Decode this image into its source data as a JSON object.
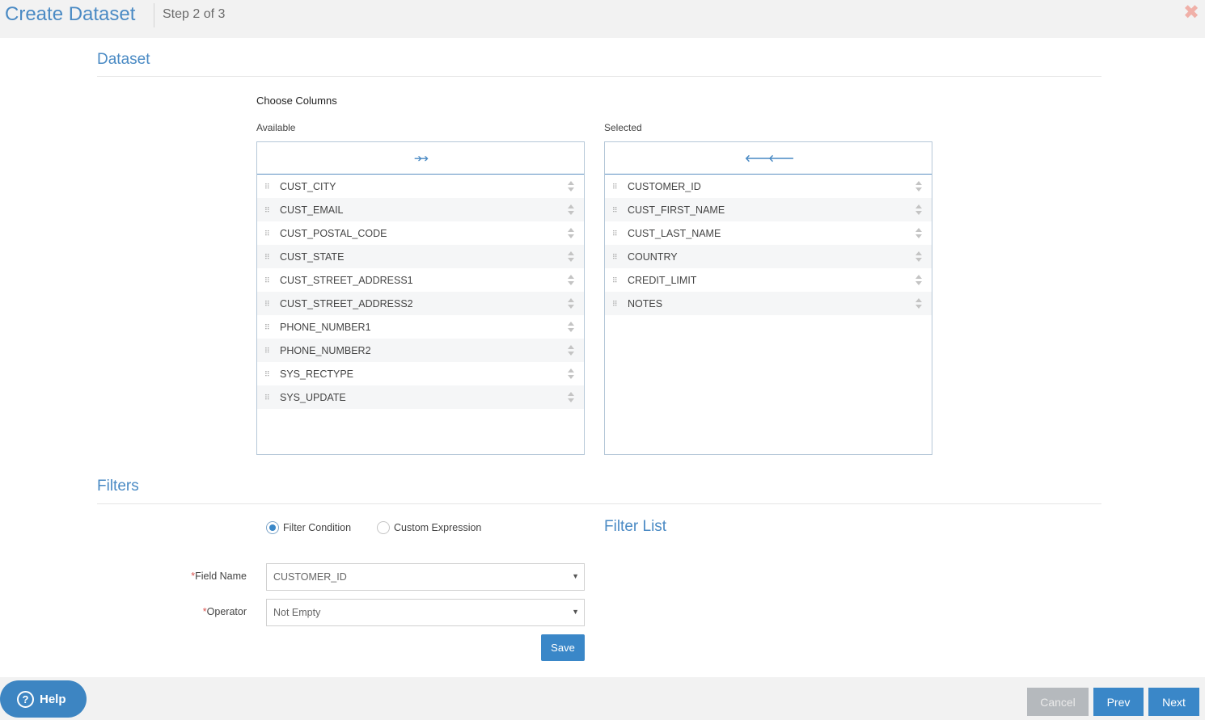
{
  "header": {
    "title": "Create Dataset",
    "step": "Step 2 of 3",
    "close_icon": "close-icon"
  },
  "dataset": {
    "section_title": "Dataset",
    "choose_columns_label": "Choose Columns",
    "available_label": "Available",
    "selected_label": "Selected",
    "move_all_right_glyph": "➔➔",
    "move_all_left_glyph": "🡐🡐",
    "available_items": [
      {
        "label": "CUST_CITY"
      },
      {
        "label": "CUST_EMAIL"
      },
      {
        "label": "CUST_POSTAL_CODE"
      },
      {
        "label": "CUST_STATE"
      },
      {
        "label": "CUST_STREET_ADDRESS1"
      },
      {
        "label": "CUST_STREET_ADDRESS2"
      },
      {
        "label": "PHONE_NUMBER1"
      },
      {
        "label": "PHONE_NUMBER2"
      },
      {
        "label": "SYS_RECTYPE"
      },
      {
        "label": "SYS_UPDATE"
      }
    ],
    "selected_items": [
      {
        "label": "CUSTOMER_ID"
      },
      {
        "label": "CUST_FIRST_NAME"
      },
      {
        "label": "CUST_LAST_NAME"
      },
      {
        "label": "COUNTRY"
      },
      {
        "label": "CREDIT_LIMIT"
      },
      {
        "label": "NOTES"
      }
    ]
  },
  "filters": {
    "section_title": "Filters",
    "radio_filter_condition": "Filter Condition",
    "radio_custom_expression": "Custom Expression",
    "selected_mode": "Filter Condition",
    "filter_list_title": "Filter List",
    "field_name_label": "Field Name",
    "field_name_value": "CUSTOMER_ID",
    "operator_label": "Operator",
    "operator_value": "Not Empty",
    "required_marker": "*",
    "save_label": "Save"
  },
  "footer": {
    "help_label": "Help",
    "help_glyph": "?",
    "cancel_label": "Cancel",
    "prev_label": "Prev",
    "next_label": "Next"
  },
  "colors": {
    "accent": "#3a87c8",
    "heading": "#4a8ac4",
    "disabled": "#b5b9bd",
    "close": "#f0b0a8"
  }
}
